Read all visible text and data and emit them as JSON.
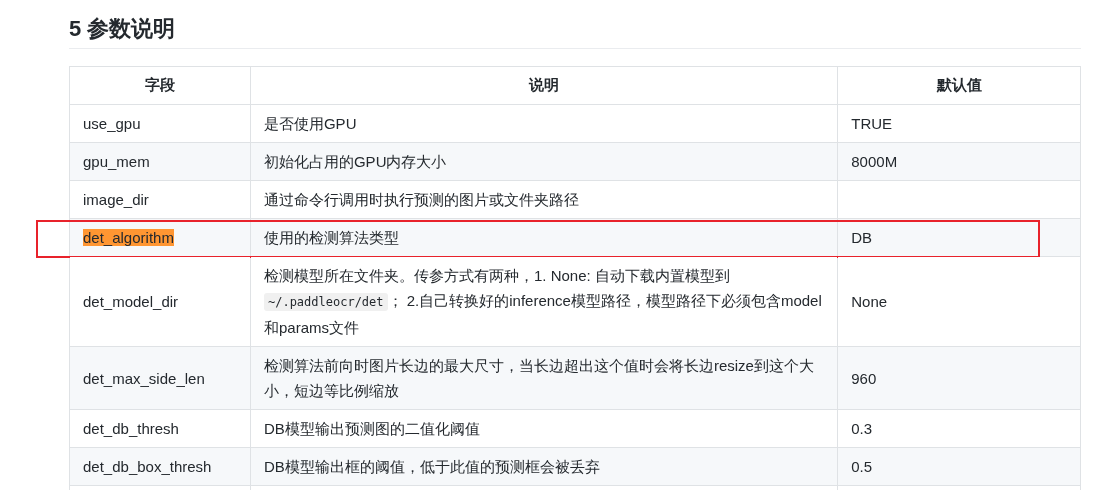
{
  "heading": "5 参数说明",
  "table": {
    "columns": [
      "字段",
      "说明",
      "默认值"
    ],
    "rows": [
      {
        "field": "use_gpu",
        "description": [
          {
            "kind": "text",
            "text": "是否使用GPU"
          }
        ],
        "default": "TRUE",
        "highlighted": false,
        "annotated": false
      },
      {
        "field": "gpu_mem",
        "description": [
          {
            "kind": "text",
            "text": "初始化占用的GPU内存大小"
          }
        ],
        "default": "8000M",
        "highlighted": false,
        "annotated": false
      },
      {
        "field": "image_dir",
        "description": [
          {
            "kind": "text",
            "text": "通过命令行调用时执行预测的图片或文件夹路径"
          }
        ],
        "highlighted": false,
        "annotated": false
      },
      {
        "field": "det_algorithm",
        "description": [
          {
            "kind": "text",
            "text": "使用的检测算法类型"
          }
        ],
        "default": "DB",
        "highlighted": true,
        "annotated": true
      },
      {
        "field": "det_model_dir",
        "description": [
          {
            "kind": "text",
            "text": "检测模型所在文件夹。传参方式有两种，1. None: 自动下载内置模型到 "
          },
          {
            "kind": "code",
            "text": "~/.paddleocr/det"
          },
          {
            "kind": "text",
            "text": "； 2.自己转换好的inference模型路径，模型路径下必须包含model和params文件"
          }
        ],
        "default": "None",
        "highlighted": false,
        "annotated": false
      },
      {
        "field": "det_max_side_len",
        "description": [
          {
            "kind": "text",
            "text": "检测算法前向时图片长边的最大尺寸，当长边超出这个值时会将长边resize到这个大小，短边等比例缩放"
          }
        ],
        "default": "960",
        "highlighted": false,
        "annotated": false
      },
      {
        "field": "det_db_thresh",
        "description": [
          {
            "kind": "text",
            "text": "DB模型输出预测图的二值化阈值"
          }
        ],
        "default": "0.3",
        "highlighted": false,
        "annotated": false
      },
      {
        "field": "det_db_box_thresh",
        "description": [
          {
            "kind": "text",
            "text": "DB模型输出框的阈值，低于此值的预测框会被丢弃"
          }
        ],
        "default": "0.5",
        "highlighted": false,
        "annotated": false
      }
    ]
  }
}
